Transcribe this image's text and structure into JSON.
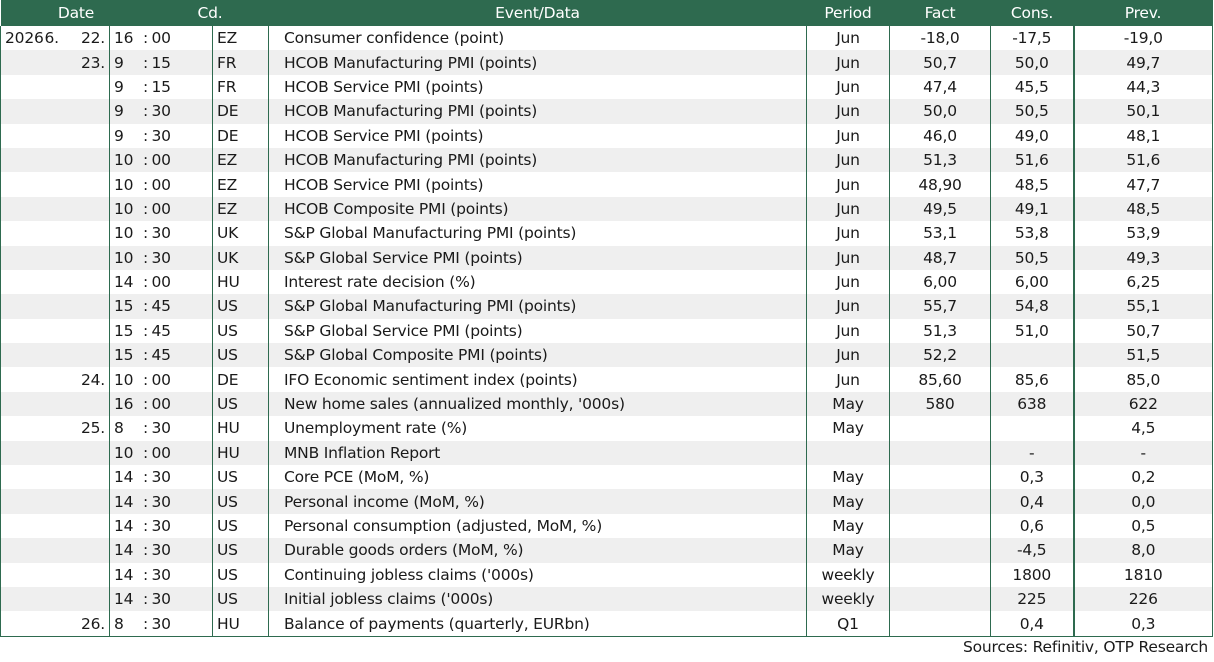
{
  "headers": {
    "date": "Date",
    "code": "Cd.",
    "event": "Event/Data",
    "period": "Period",
    "fact": "Fact",
    "cons": "Cons.",
    "prev": "Prev."
  },
  "time_separator": ":",
  "rows": [
    {
      "year": "2026",
      "month": "6.",
      "day": "22.",
      "hour": "16",
      "minute": "00",
      "code": "EZ",
      "event": "Consumer confidence (point)",
      "period": "Jun",
      "fact": "-18,0",
      "cons": "-17,5",
      "prev": "-19,0"
    },
    {
      "year": "",
      "month": "",
      "day": "23.",
      "hour": "9",
      "minute": "15",
      "code": "FR",
      "event": "HCOB Manufacturing PMI (points)",
      "period": "Jun",
      "fact": "50,7",
      "cons": "50,0",
      "prev": "49,7"
    },
    {
      "year": "",
      "month": "",
      "day": "",
      "hour": "9",
      "minute": "15",
      "code": "FR",
      "event": "HCOB Service PMI (points)",
      "period": "Jun",
      "fact": "47,4",
      "cons": "45,5",
      "prev": "44,3"
    },
    {
      "year": "",
      "month": "",
      "day": "",
      "hour": "9",
      "minute": "30",
      "code": "DE",
      "event": "HCOB Manufacturing PMI (points)",
      "period": "Jun",
      "fact": "50,0",
      "cons": "50,5",
      "prev": "50,1"
    },
    {
      "year": "",
      "month": "",
      "day": "",
      "hour": "9",
      "minute": "30",
      "code": "DE",
      "event": "HCOB Service PMI (points)",
      "period": "Jun",
      "fact": "46,0",
      "cons": "49,0",
      "prev": "48,1"
    },
    {
      "year": "",
      "month": "",
      "day": "",
      "hour": "10",
      "minute": "00",
      "code": "EZ",
      "event": "HCOB Manufacturing PMI (points)",
      "period": "Jun",
      "fact": "51,3",
      "cons": "51,6",
      "prev": "51,6"
    },
    {
      "year": "",
      "month": "",
      "day": "",
      "hour": "10",
      "minute": "00",
      "code": "EZ",
      "event": "HCOB Service PMI (points)",
      "period": "Jun",
      "fact": "48,90",
      "cons": "48,5",
      "prev": "47,7"
    },
    {
      "year": "",
      "month": "",
      "day": "",
      "hour": "10",
      "minute": "00",
      "code": "EZ",
      "event": "HCOB Composite PMI (points)",
      "period": "Jun",
      "fact": "49,5",
      "cons": "49,1",
      "prev": "48,5"
    },
    {
      "year": "",
      "month": "",
      "day": "",
      "hour": "10",
      "minute": "30",
      "code": "UK",
      "event": "S&P Global Manufacturing PMI (points)",
      "period": "Jun",
      "fact": "53,1",
      "cons": "53,8",
      "prev": "53,9"
    },
    {
      "year": "",
      "month": "",
      "day": "",
      "hour": "10",
      "minute": "30",
      "code": "UK",
      "event": "S&P Global Service PMI (points)",
      "period": "Jun",
      "fact": "48,7",
      "cons": "50,5",
      "prev": "49,3"
    },
    {
      "year": "",
      "month": "",
      "day": "",
      "hour": "14",
      "minute": "00",
      "code": "HU",
      "event": "Interest rate decision (%)",
      "period": "Jun",
      "fact": "6,00",
      "cons": "6,00",
      "prev": "6,25"
    },
    {
      "year": "",
      "month": "",
      "day": "",
      "hour": "15",
      "minute": "45",
      "code": "US",
      "event": "S&P Global Manufacturing PMI (points)",
      "period": "Jun",
      "fact": "55,7",
      "cons": "54,8",
      "prev": "55,1"
    },
    {
      "year": "",
      "month": "",
      "day": "",
      "hour": "15",
      "minute": "45",
      "code": "US",
      "event": "S&P Global Service PMI (points)",
      "period": "Jun",
      "fact": "51,3",
      "cons": "51,0",
      "prev": "50,7"
    },
    {
      "year": "",
      "month": "",
      "day": "",
      "hour": "15",
      "minute": "45",
      "code": "US",
      "event": "S&P Global Composite PMI (points)",
      "period": "Jun",
      "fact": "52,2",
      "cons": "",
      "prev": "51,5"
    },
    {
      "year": "",
      "month": "",
      "day": "24.",
      "hour": "10",
      "minute": "00",
      "code": "DE",
      "event": "IFO Economic sentiment index (points)",
      "period": "Jun",
      "fact": "85,60",
      "cons": "85,6",
      "prev": "85,0"
    },
    {
      "year": "",
      "month": "",
      "day": "",
      "hour": "16",
      "minute": "00",
      "code": "US",
      "event": "New home sales (annualized monthly, '000s)",
      "period": "May",
      "fact": "580",
      "cons": "638",
      "prev": "622"
    },
    {
      "year": "",
      "month": "",
      "day": "25.",
      "hour": "8",
      "minute": "30",
      "code": "HU",
      "event": "Unemployment rate (%)",
      "period": "May",
      "fact": "",
      "cons": "",
      "prev": "4,5"
    },
    {
      "year": "",
      "month": "",
      "day": "",
      "hour": "10",
      "minute": "00",
      "code": "HU",
      "event": "MNB Inflation Report",
      "period": "",
      "fact": "",
      "cons": "-",
      "prev": "-"
    },
    {
      "year": "",
      "month": "",
      "day": "",
      "hour": "14",
      "minute": "30",
      "code": "US",
      "event": "Core PCE (MoM, %)",
      "period": "May",
      "fact": "",
      "cons": "0,3",
      "prev": "0,2"
    },
    {
      "year": "",
      "month": "",
      "day": "",
      "hour": "14",
      "minute": "30",
      "code": "US",
      "event": "Personal income (MoM, %)",
      "period": "May",
      "fact": "",
      "cons": "0,4",
      "prev": "0,0"
    },
    {
      "year": "",
      "month": "",
      "day": "",
      "hour": "14",
      "minute": "30",
      "code": "US",
      "event": "Personal consumption (adjusted, MoM, %)",
      "period": "May",
      "fact": "",
      "cons": "0,6",
      "prev": "0,5"
    },
    {
      "year": "",
      "month": "",
      "day": "",
      "hour": "14",
      "minute": "30",
      "code": "US",
      "event": "Durable goods orders (MoM, %)",
      "period": "May",
      "fact": "",
      "cons": "-4,5",
      "prev": "8,0"
    },
    {
      "year": "",
      "month": "",
      "day": "",
      "hour": "14",
      "minute": "30",
      "code": "US",
      "event": "Continuing jobless claims ('000s)",
      "period": "weekly",
      "fact": "",
      "cons": "1800",
      "prev": "1810"
    },
    {
      "year": "",
      "month": "",
      "day": "",
      "hour": "14",
      "minute": "30",
      "code": "US",
      "event": "Initial jobless claims ('000s)",
      "period": "weekly",
      "fact": "",
      "cons": "225",
      "prev": "226"
    },
    {
      "year": "",
      "month": "",
      "day": "26.",
      "hour": "8",
      "minute": "30",
      "code": "HU",
      "event": "Balance of payments (quarterly, EURbn)",
      "period": "Q1",
      "fact": "",
      "cons": "0,4",
      "prev": "0,3"
    }
  ],
  "source": "Sources: Refinitiv, OTP Research"
}
